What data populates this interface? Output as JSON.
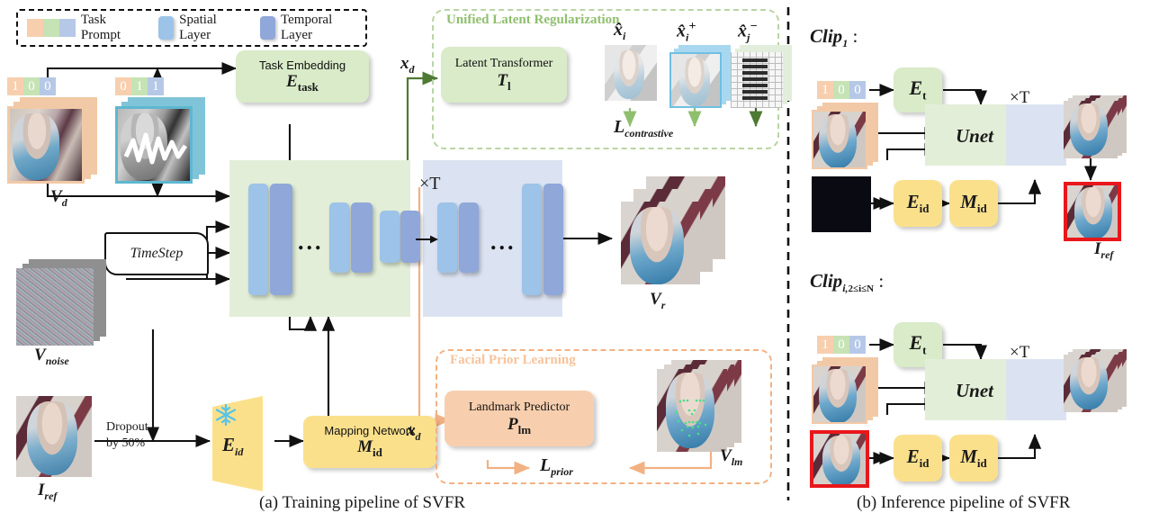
{
  "legend": {
    "items": [
      {
        "name": "task-prompt",
        "label": "Task Prompt",
        "swatches": [
          "#f7cfae",
          "#c5e3b4",
          "#b6c8e8"
        ]
      },
      {
        "name": "spatial-layer",
        "label": "Spatial Layer",
        "color": "#9dc3e8"
      },
      {
        "name": "temporal-layer",
        "label": "Temporal Layer",
        "color": "#8fa7d9"
      }
    ]
  },
  "training": {
    "caption": "(a) Training pipeline of SVFR",
    "task_embedding": {
      "title": "Task Embedding",
      "symbol": "E",
      "sub": "task"
    },
    "timestep": "TimeStep",
    "inputs": {
      "vd_label": "V",
      "vd_sub": "d",
      "vnoise_label": "V",
      "vnoise_sub": "noise",
      "iref_label": "I",
      "iref_sub": "ref",
      "dropout_line1": "Dropout",
      "dropout_line2": "by 50%",
      "prompt_a": [
        "1",
        "0",
        "0"
      ],
      "prompt_b": [
        "0",
        "1",
        "1"
      ]
    },
    "id_branch": {
      "eid_symbol": "E",
      "eid_sub": "id",
      "mapping_title": "Mapping Network",
      "mapping_symbol": "M",
      "mapping_sub": "id",
      "snowflake": "frozen-snowflake-icon"
    },
    "unet": {
      "times_t": "×T",
      "dots": "..."
    },
    "xd_label": "x",
    "xd_sub": "d",
    "output": {
      "vr_label": "V",
      "vr_sub": "r"
    },
    "latent_reg": {
      "title": "Unified Latent Regularization",
      "box_title": "Latent Transformer",
      "box_symbol": "T",
      "box_sub": "l",
      "anchors": [
        "x̂",
        "x̂",
        "x̂"
      ],
      "anchor_subs": [
        "i",
        "i",
        "j"
      ],
      "anchor_sups": [
        "",
        "+",
        "−"
      ],
      "loss": "L",
      "loss_sub": "contrastive",
      "color": "#8fbf6d"
    },
    "facial_prior": {
      "title": "Facial Prior Learning",
      "box_title": "Landmark Predictor",
      "box_symbol": "P",
      "box_sub": "lm",
      "vlm_label": "V",
      "vlm_sub": "lm",
      "loss": "L",
      "loss_sub": "prior",
      "color": "#f5bb8b"
    }
  },
  "inference": {
    "caption": "(b) Inference pipeline of SVFR",
    "clip1": {
      "title": "Clip",
      "title_sub": "1",
      "colon": ":",
      "prompt": [
        "1",
        "0",
        "0"
      ],
      "et_symbol": "E",
      "et_sub": "t",
      "eid_symbol": "E",
      "eid_sub": "id",
      "mid_symbol": "M",
      "mid_sub": "id",
      "unet": "Unet",
      "times_t": "×T",
      "iref_label": "I",
      "iref_sub": "ref"
    },
    "clipi": {
      "title": "Clip",
      "title_sub": "i,",
      "range": "2≤i≤N",
      "colon": ":",
      "prompt": [
        "1",
        "0",
        "0"
      ],
      "et_symbol": "E",
      "et_sub": "t",
      "eid_symbol": "E",
      "eid_sub": "id",
      "mid_symbol": "M",
      "mid_sub": "id",
      "unet": "Unet",
      "times_t": "×T"
    }
  },
  "colors": {
    "green_panel": "#e3eed8",
    "blue_panel": "#dbe3f2",
    "green_box": "#d9ebc8",
    "orange_box": "#f8cfae",
    "yellow_box": "#fbe08c",
    "spatial": "#9dc3e8",
    "temporal": "#8fa7d9",
    "green_arrow": "#4e7a33",
    "orange_arrow": "#f2b183",
    "red_border": "#e8171b"
  }
}
